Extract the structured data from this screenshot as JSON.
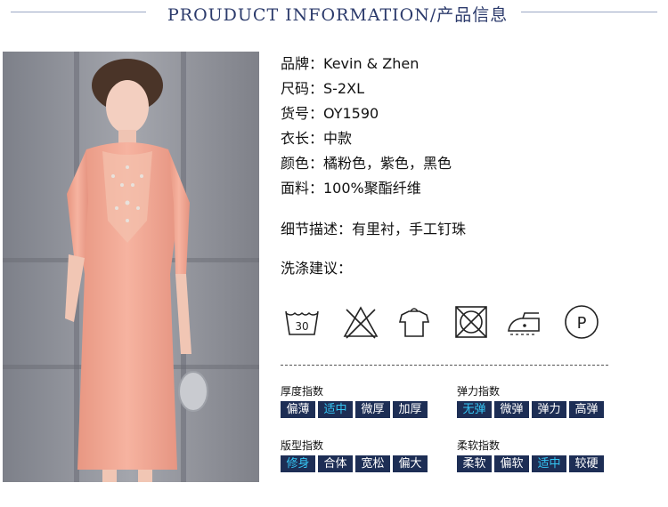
{
  "header": {
    "title": "PROUDUCT INFORMATION/产品信息"
  },
  "info": {
    "brand": "品牌：Kevin & Zhen",
    "size": "尺码：S-2XL",
    "item_no": "货号：OY1590",
    "length": "衣长：中款",
    "colors": "颜色：橘粉色，紫色，黑色",
    "fabric": "面料：100%聚酯纤维",
    "detail": "细节描述：有里衬，手工钉珠",
    "wash_title": "洗涤建议："
  },
  "care_icons": [
    {
      "icon": "wash-30-icon",
      "text": "30"
    },
    {
      "icon": "no-bleach-icon"
    },
    {
      "icon": "hang-dry-icon"
    },
    {
      "icon": "no-tumble-dry-icon"
    },
    {
      "icon": "iron-low-icon"
    },
    {
      "icon": "dry-clean-p-icon",
      "text": "P"
    }
  ],
  "indices": {
    "thickness": {
      "label": "厚度指数",
      "options": [
        "偏薄",
        "适中",
        "微厚",
        "加厚"
      ],
      "selected": "适中"
    },
    "elasticity": {
      "label": "弹力指数",
      "options": [
        "无弹",
        "微弹",
        "弹力",
        "高弹"
      ],
      "selected": "无弹"
    },
    "fit": {
      "label": "版型指数",
      "options": [
        "修身",
        "合体",
        "宽松",
        "偏大"
      ],
      "selected": "修身"
    },
    "softness": {
      "label": "柔软指数",
      "options": [
        "柔软",
        "偏软",
        "适中",
        "较硬"
      ],
      "selected": "适中"
    }
  },
  "colors": {
    "index_bg": "#1d2e55",
    "index_selected": "#35c6f4",
    "index_text": "#ffffff",
    "title": "#2b3a6b",
    "dress": "#f0a58f"
  }
}
